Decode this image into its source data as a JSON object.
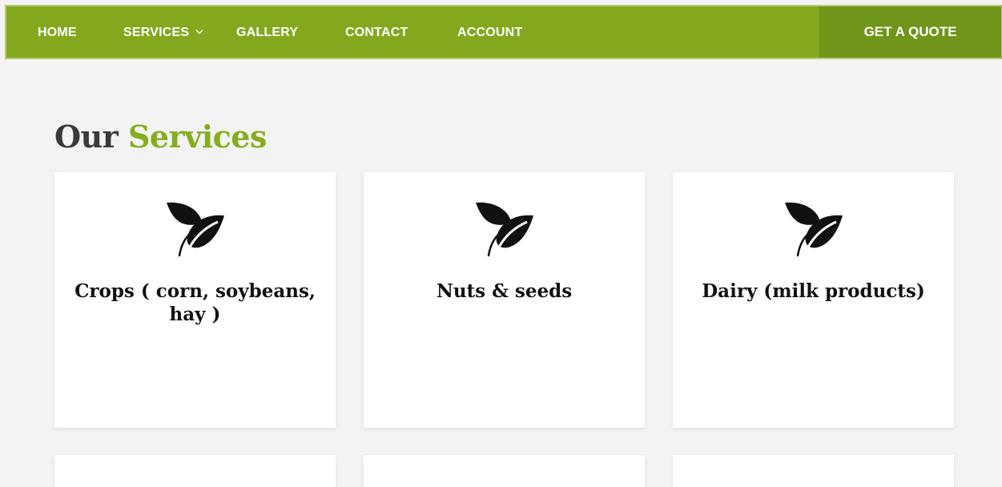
{
  "nav": {
    "items": [
      {
        "label": "HOME"
      },
      {
        "label": "SERVICES"
      },
      {
        "label": "GALLERY"
      },
      {
        "label": "CONTACT"
      },
      {
        "label": "ACCOUNT"
      }
    ],
    "cta_label": "GET A QUOTE"
  },
  "section": {
    "title_part1": "Our",
    "title_part2": "Services"
  },
  "services": [
    {
      "title": "Crops ( corn, soybeans, hay )",
      "icon": "leaf-icon"
    },
    {
      "title": "Nuts & seeds",
      "icon": "leaf-icon"
    },
    {
      "title": "Dairy (milk products)",
      "icon": "leaf-icon"
    }
  ],
  "colors": {
    "nav_bg": "#83a81e",
    "cta_bg": "#6f951a",
    "accent": "#86ad1c",
    "page_bg": "#f3f3f3",
    "title_dark": "#3a3a3a"
  }
}
